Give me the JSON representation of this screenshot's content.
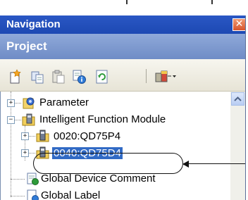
{
  "panel": {
    "title": "Navigation",
    "close_glyph": "✕",
    "header": "Project"
  },
  "toolbar": {
    "buttons": [
      {
        "name": "new-data-icon"
      },
      {
        "name": "copy-icon"
      },
      {
        "name": "paste-icon"
      },
      {
        "name": "properties-icon"
      },
      {
        "name": "refresh-icon"
      },
      {
        "name": "module-config-dropdown-icon"
      }
    ]
  },
  "tree": {
    "items": [
      {
        "label": "Parameter",
        "expander": "+",
        "icon": "parameter-icon"
      },
      {
        "label": "Intelligent Function Module",
        "expander": "−",
        "icon": "module-folder-icon"
      },
      {
        "label": "0020:QD75P4",
        "expander": "+",
        "icon": "module-icon"
      },
      {
        "label": "0040:QD75D4",
        "expander": "+",
        "icon": "module-icon",
        "selected": true
      },
      {
        "label": "Global Device Comment",
        "icon": "comment-icon"
      },
      {
        "label": "Global Label",
        "icon": "label-icon"
      }
    ]
  },
  "colors": {
    "title_bar": "#1d49b3",
    "header": "#7d98cf",
    "selection": "#316ac5"
  }
}
